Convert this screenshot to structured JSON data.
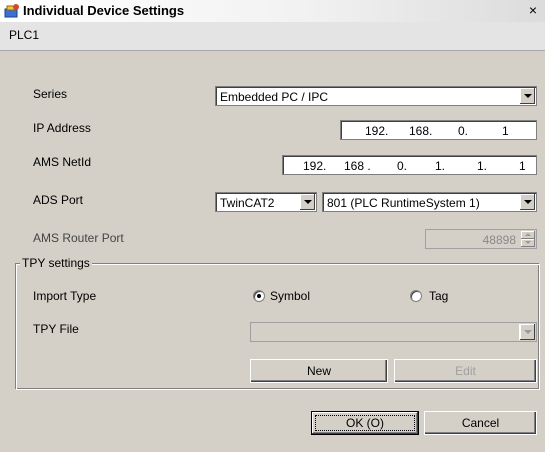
{
  "window": {
    "title": "Individual Device Settings",
    "close_glyph": "×"
  },
  "device": {
    "name": "PLC1"
  },
  "settings": {
    "series_label": "Series",
    "series_value": "Embedded PC / IPC",
    "ip_label": "IP Address",
    "ip_parts": [
      "192.",
      "168.",
      "0.",
      "1"
    ],
    "ams_label": "AMS NetId",
    "ams_parts": [
      "192.",
      "168 .",
      "0.",
      "1.",
      "1.",
      "1"
    ],
    "ads_label": "ADS Port",
    "ads_version": "TwinCAT2",
    "ads_port": "801 (PLC RuntimeSystem 1)",
    "router_label": "AMS Router Port",
    "router_value": "48898"
  },
  "tpy": {
    "group_title": "TPY settings",
    "import_label": "Import Type",
    "options": [
      {
        "label": "Symbol",
        "checked": true
      },
      {
        "label": "Tag",
        "checked": false
      }
    ],
    "file_label": "TPY File",
    "file_value": "",
    "new_label": "New",
    "edit_label": "Edit"
  },
  "footer": {
    "ok_label": "OK (O)",
    "cancel_label": "Cancel"
  },
  "icons": {
    "app": "gear-plug-icon",
    "close": "close-icon"
  }
}
